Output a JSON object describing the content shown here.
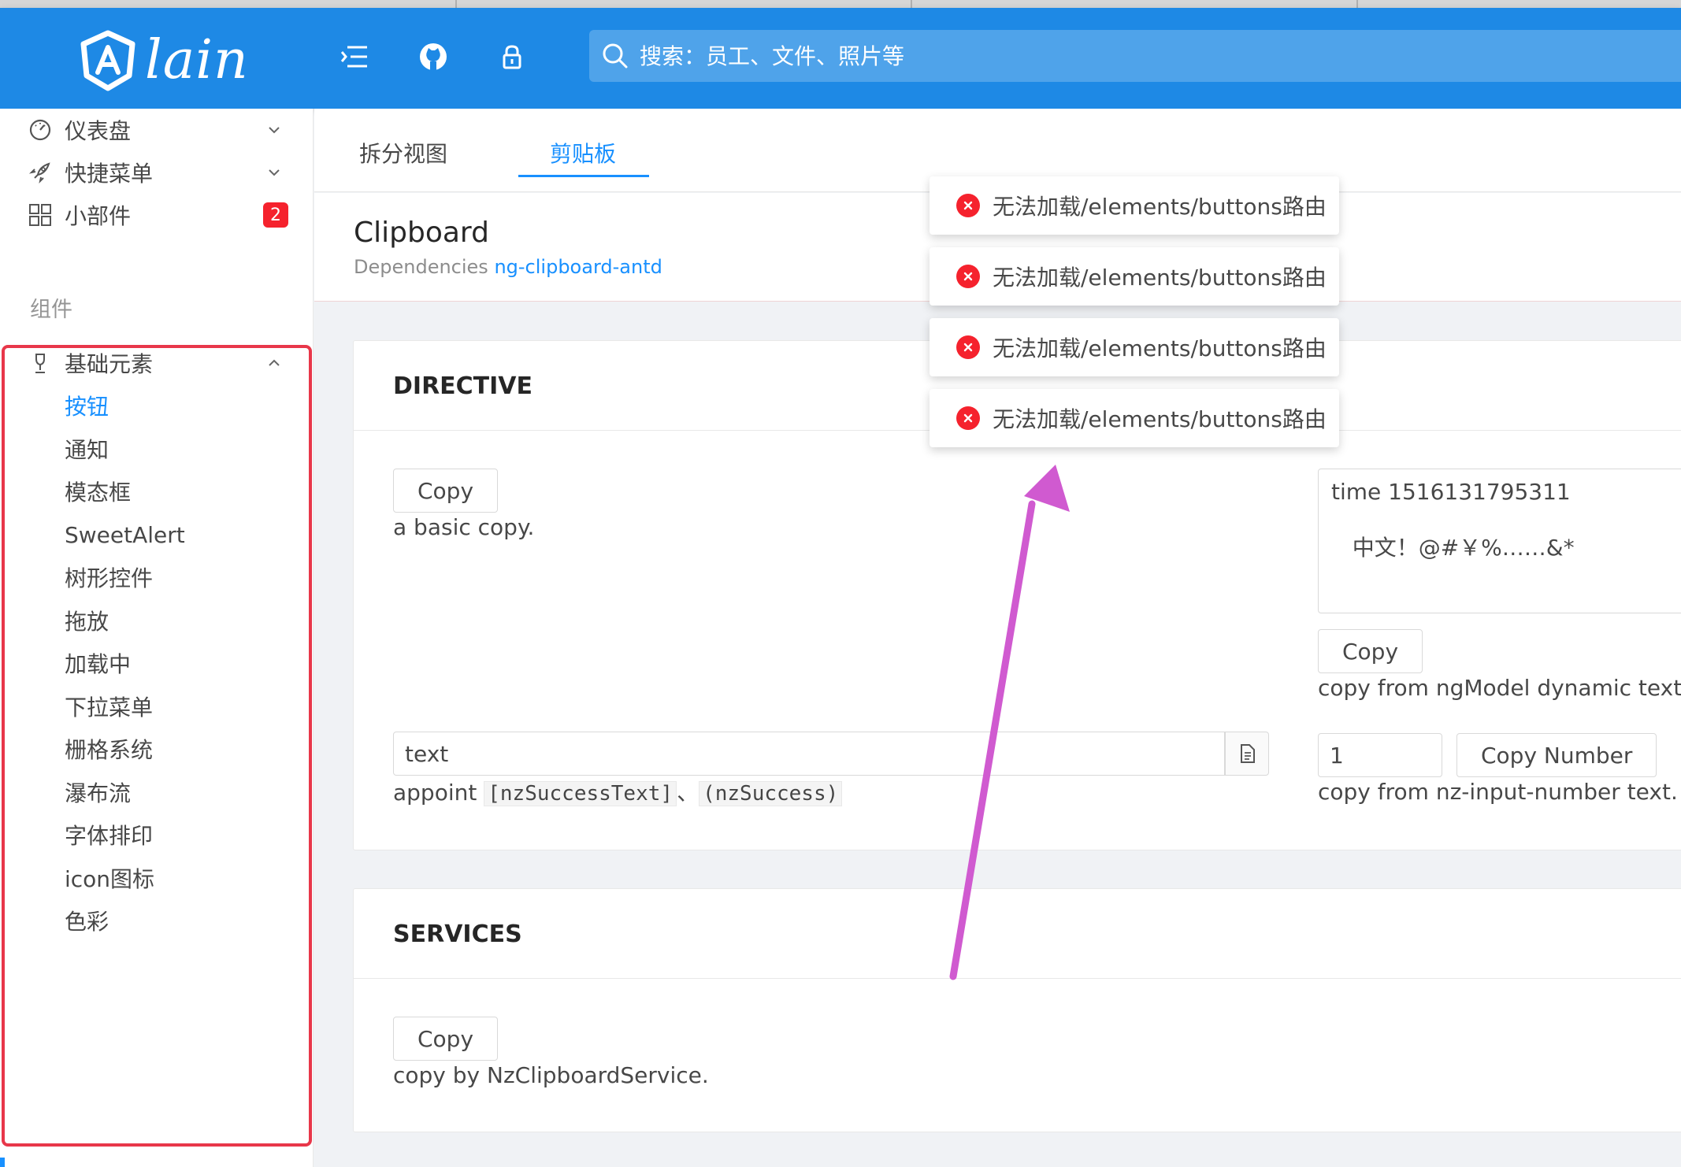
{
  "header": {
    "logo_text": "lain",
    "search_placeholder": "搜索：员工、文件、照片等",
    "colors": {
      "bar": "#1e89e5",
      "accent": "#1890ff",
      "danger": "#f5222d",
      "outline": "#e8374a",
      "arrow": "#d05ad0"
    }
  },
  "icons": {
    "menu": "menu-fold-icon",
    "github": "github-icon",
    "lock": "lock-icon",
    "search": "search-icon"
  },
  "sidebar": {
    "items": [
      {
        "label": "仪表盘",
        "icon": "dashboard-icon",
        "expandable": true
      },
      {
        "label": "快捷菜单",
        "icon": "rocket-icon",
        "expandable": true
      },
      {
        "label": "小部件",
        "icon": "appstore-icon",
        "badge": "2"
      }
    ],
    "group_label": "组件",
    "expanded_item": {
      "label": "基础元素",
      "icon": "trophy-icon"
    },
    "sub_items": [
      {
        "label": "按钮",
        "active": true
      },
      {
        "label": "通知"
      },
      {
        "label": "模态框"
      },
      {
        "label": "SweetAlert"
      },
      {
        "label": "树形控件"
      },
      {
        "label": "拖放"
      },
      {
        "label": "加载中"
      },
      {
        "label": "下拉菜单"
      },
      {
        "label": "栅格系统"
      },
      {
        "label": "瀑布流"
      },
      {
        "label": "字体排印"
      },
      {
        "label": "icon图标"
      },
      {
        "label": "色彩"
      }
    ]
  },
  "tabs": [
    {
      "label": "拆分视图",
      "active": false
    },
    {
      "label": "剪贴板",
      "active": true
    }
  ],
  "page": {
    "title": "Clipboard",
    "desc_prefix": "Dependencies",
    "desc_link": "ng-clipboard-antd"
  },
  "directive": {
    "title": "DIRECTIVE",
    "basic": {
      "button": "Copy",
      "desc": "a basic copy."
    },
    "ngmodel": {
      "textarea_value": "time 1516131795311\n\n   中文！@#￥%……&*",
      "button": "Copy",
      "desc": "copy from ngModel dynamic text."
    },
    "appoint": {
      "input_value": "text",
      "desc_prefix": "appoint ",
      "code1": "[nzSuccessText]",
      "sep": "、",
      "code2": "(nzSuccess)"
    },
    "number": {
      "input_value": "1",
      "button": "Copy Number",
      "desc": "copy from nz-input-number text."
    }
  },
  "services": {
    "title": "SERVICES",
    "button": "Copy",
    "desc": "copy by NzClipboardService."
  },
  "notifications": [
    {
      "message": "无法加载/elements/buttons路由"
    },
    {
      "message": "无法加载/elements/buttons路由"
    },
    {
      "message": "无法加载/elements/buttons路由"
    },
    {
      "message": "无法加载/elements/buttons路由"
    }
  ]
}
